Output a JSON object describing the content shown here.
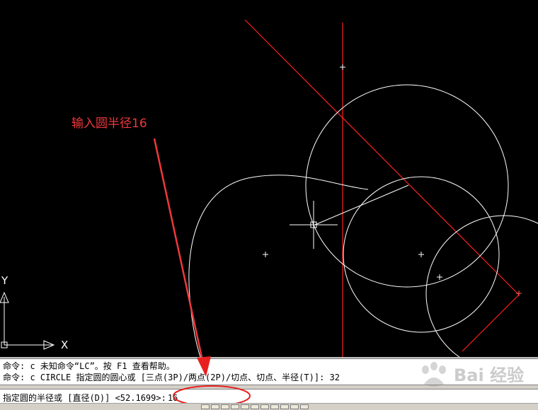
{
  "annotation": {
    "text": "输入圆半径16",
    "color": "#f0383c"
  },
  "ucs": {
    "x_label": "X",
    "y_label": "Y"
  },
  "command_window": {
    "history": [
      "命令: c 未知命令“LC”。按 F1 查看帮助。",
      "命令: c CIRCLE 指定圆的圆心或 [三点(3P)/两点(2P)/切点、切点、半径(T)]: 32"
    ],
    "prompt": "指定圆的半径或 [直径(D)] <52.1699>:",
    "input_value": "16"
  },
  "watermark": {
    "text": "Bai 经验"
  },
  "colors": {
    "background": "#000000",
    "geometry": "#ffffff",
    "construction": "#ff2020",
    "annotation": "#f0383c"
  },
  "icons": [
    "crosshair-cursor-icon",
    "ucs-icon",
    "baidu-paw-icon"
  ]
}
